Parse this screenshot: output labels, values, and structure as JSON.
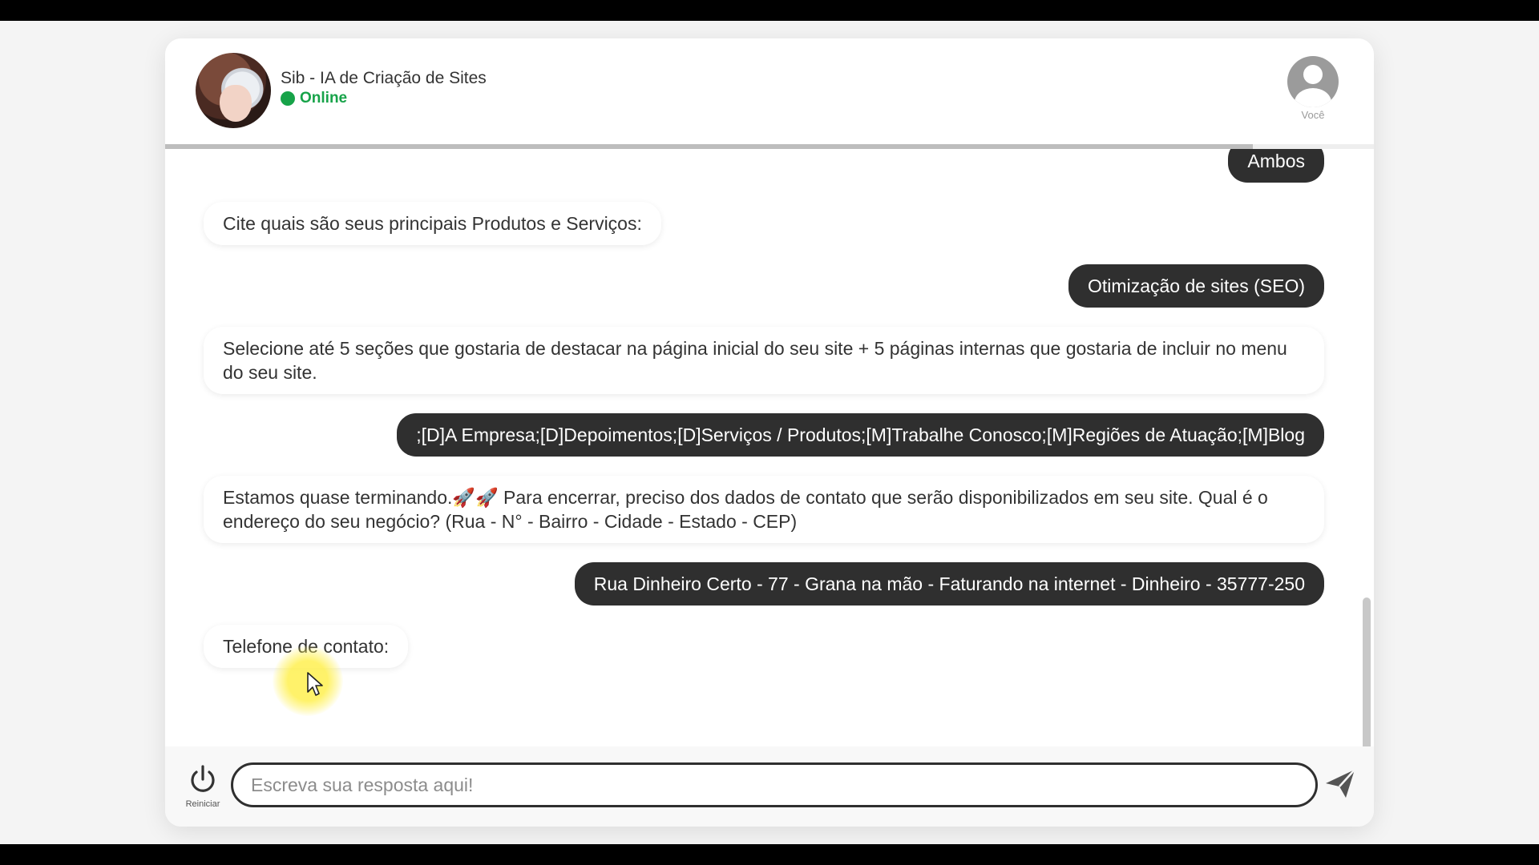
{
  "header": {
    "bot_name": "Sib - IA de Criação de Sites",
    "status": "Online",
    "user_label": "Você",
    "progress": 0.9
  },
  "messages": [
    {
      "sender": "user",
      "text": "Ambos"
    },
    {
      "sender": "bot",
      "text": "Cite quais são seus principais Produtos e Serviços:"
    },
    {
      "sender": "user",
      "text": "Otimização de sites (SEO)"
    },
    {
      "sender": "bot",
      "text": "Selecione até 5 seções que gostaria de destacar na página inicial do seu site + 5 páginas internas que gostaria de incluir no menu do seu site."
    },
    {
      "sender": "user",
      "text": ";[D]A Empresa;[D]Depoimentos;[D]Serviços / Produtos;[M]Trabalhe Conosco;[M]Regiões de Atuação;[M]Blog"
    },
    {
      "sender": "bot",
      "text": "Estamos quase terminando.🚀🚀 Para encerrar, preciso dos dados de contato que serão disponibilizados em seu site. Qual é o endereço do seu negócio? (Rua - N° - Bairro - Cidade - Estado - CEP)"
    },
    {
      "sender": "user",
      "text": "Rua Dinheiro Certo - 77 - Grana na mão - Faturando na internet - Dinheiro - 35777-250"
    },
    {
      "sender": "bot",
      "text": "Telefone de contato:"
    }
  ],
  "composer": {
    "placeholder": "Escreva sua resposta aqui!",
    "restart_label": "Reiniciar"
  },
  "icons": {
    "restart": "power-icon",
    "send": "send-icon",
    "user": "user-avatar-icon"
  },
  "colors": {
    "online": "#17a349",
    "user_bubble": "#2f2f2f",
    "bot_bubble": "#ffffff"
  }
}
